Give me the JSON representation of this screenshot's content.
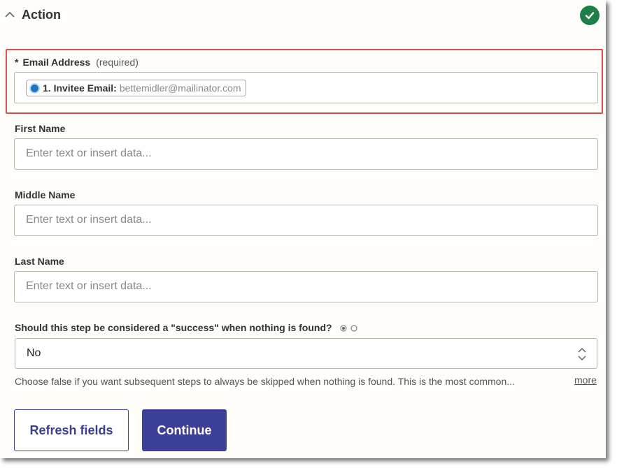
{
  "header": {
    "title": "Action"
  },
  "email": {
    "label": "Email Address",
    "required_star": "*",
    "required_text": "(required)",
    "pill_key": "1. Invitee Email:",
    "pill_value": "bettemidler@mailinator.com"
  },
  "first_name": {
    "label": "First Name",
    "placeholder": "Enter text or insert data..."
  },
  "middle_name": {
    "label": "Middle Name",
    "placeholder": "Enter text or insert data..."
  },
  "last_name": {
    "label": "Last Name",
    "placeholder": "Enter text or insert data..."
  },
  "success": {
    "label": "Should this step be considered a \"success\" when nothing is found?",
    "selected": "No",
    "help": "Choose false if you want subsequent steps to always be skipped when nothing is found. This is the most common...",
    "more": "more"
  },
  "buttons": {
    "refresh": "Refresh fields",
    "continue": "Continue"
  },
  "colors": {
    "accent": "#3c3f98",
    "success": "#1e7f4a",
    "highlight": "#e04a4a"
  }
}
